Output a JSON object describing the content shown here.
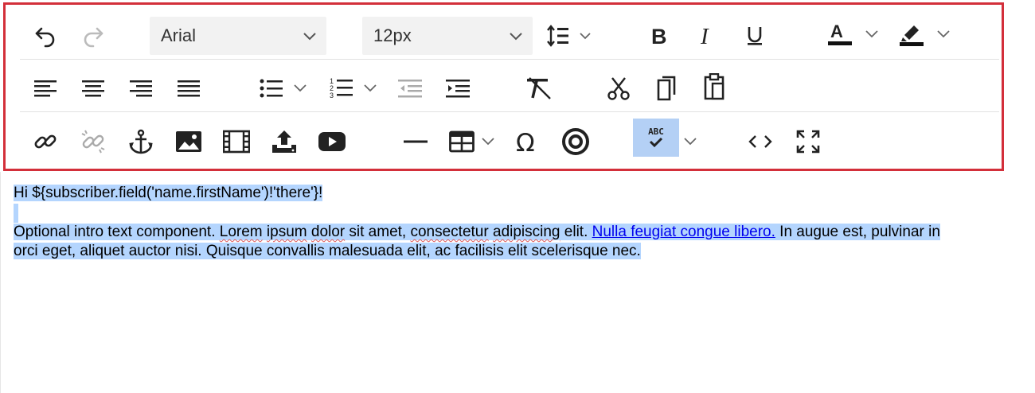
{
  "toolbar": {
    "font_family": {
      "value": "Arial",
      "options": [
        "Arial"
      ]
    },
    "font_size": {
      "value": "12px",
      "options": [
        "12px"
      ]
    },
    "icons": {
      "row1": [
        "undo-icon",
        "redo-icon",
        "line-height-icon",
        "bold-icon",
        "italic-icon",
        "underline-icon",
        "text-color-icon",
        "highlight-color-icon"
      ],
      "row2": [
        "align-left-icon",
        "align-center-icon",
        "align-right-icon",
        "align-justify-icon",
        "bullet-list-icon",
        "numbered-list-icon",
        "outdent-icon",
        "indent-icon",
        "clear-formatting-icon",
        "cut-icon",
        "copy-icon",
        "paste-icon"
      ],
      "row3": [
        "link-icon",
        "unlink-icon",
        "anchor-icon",
        "image-icon",
        "video-icon",
        "upload-icon",
        "youtube-icon",
        "horizontal-rule-icon",
        "table-icon",
        "special-character-icon",
        "target-icon",
        "spellcheck-icon",
        "code-view-icon",
        "fullscreen-icon"
      ]
    },
    "spellcheck_label": "ABC",
    "text_color": "#111111",
    "highlight_color": "#111111",
    "accent": "#d32f3a"
  },
  "editor": {
    "line1": "Hi ${subscriber.field('name.firstName')!'there'}!",
    "para_a": "Optional intro text component. ",
    "w_lorem": "Lorem",
    "sp1": " ",
    "w_ipsum": "ipsum",
    "sp2": " ",
    "w_dolor": "dolor",
    "para_b": " sit amet, ",
    "w_consectetur": "consectetur",
    "sp3": " ",
    "w_adipiscing": "adipiscing",
    "para_c": " elit. ",
    "link": "Nulla feugiat congue libero.",
    "para_d": " In augue est, pulvinar in",
    "line4": "orci eget, aliquet auctor nisi. Quisque convallis malesuada elit, ac facilisis elit scelerisque nec."
  }
}
